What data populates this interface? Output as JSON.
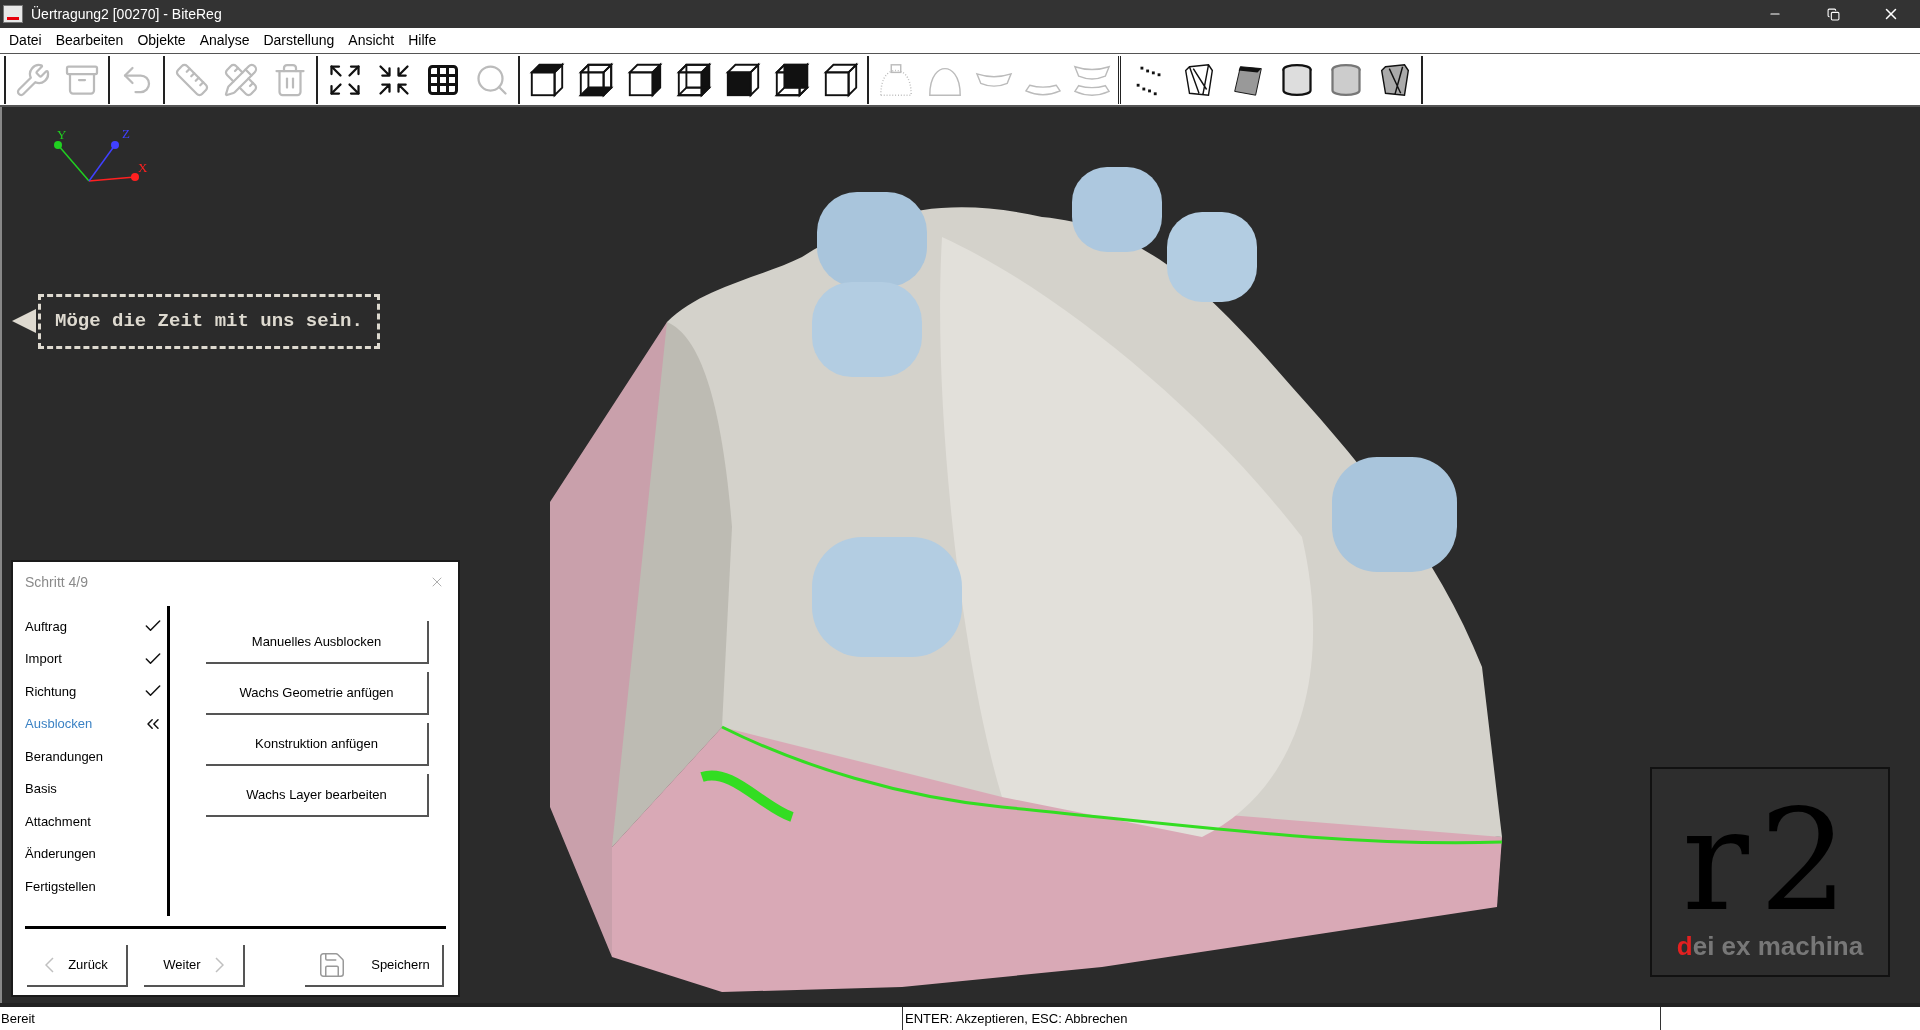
{
  "window": {
    "title": "Üertragung2 [00270] - BiteReg"
  },
  "menu": [
    "Datei",
    "Bearbeiten",
    "Objekte",
    "Analyse",
    "Darstellung",
    "Ansicht",
    "Hilfe"
  ],
  "toolbar": {
    "groups": [
      [
        {
          "kind": "wrench",
          "disabled": true
        },
        {
          "kind": "archive",
          "disabled": true
        }
      ],
      [
        {
          "kind": "undo",
          "disabled": true
        }
      ],
      [
        {
          "kind": "ruler",
          "disabled": true
        },
        {
          "kind": "edit-tools",
          "disabled": true
        },
        {
          "kind": "trash",
          "disabled": true
        }
      ],
      [
        {
          "kind": "zoom-fit",
          "disabled": false
        },
        {
          "kind": "zoom-center",
          "disabled": false
        },
        {
          "kind": "grid",
          "disabled": false
        },
        {
          "kind": "magnifier",
          "disabled": true
        }
      ],
      [
        {
          "kind": "cube-top",
          "disabled": false
        },
        {
          "kind": "wire-cube-bottom",
          "disabled": false
        },
        {
          "kind": "cube-right",
          "disabled": false
        },
        {
          "kind": "wire-cube-right",
          "disabled": false
        },
        {
          "kind": "cube-front",
          "disabled": false
        },
        {
          "kind": "wire-cube-back",
          "disabled": false
        },
        {
          "kind": "cube-plain",
          "disabled": false
        }
      ],
      [
        {
          "kind": "jaw-base",
          "disabled": true
        },
        {
          "kind": "arch",
          "disabled": true
        },
        {
          "kind": "upper-teeth",
          "disabled": true
        },
        {
          "kind": "lower-teeth",
          "disabled": true
        },
        {
          "kind": "both-teeth",
          "disabled": true
        }
      ],
      [
        {
          "kind": "points",
          "disabled": false
        },
        {
          "kind": "mesh",
          "disabled": false
        },
        {
          "kind": "prism",
          "disabled": false
        },
        {
          "kind": "cylinder",
          "disabled": false
        },
        {
          "kind": "smooth-cylinder",
          "disabled": false
        },
        {
          "kind": "wire-cylinder",
          "disabled": false
        }
      ]
    ]
  },
  "viewport": {
    "axes": [
      {
        "label": "X",
        "color": "#ff2020"
      },
      {
        "label": "Y",
        "color": "#20d020"
      },
      {
        "label": "Z",
        "color": "#4040ff"
      }
    ],
    "hint": "Möge die Zeit mit uns sein.",
    "logo": {
      "mark": "r2",
      "tagline": "dei ex machina"
    }
  },
  "wizard": {
    "title": "Schritt 4/9",
    "steps": [
      {
        "label": "Auftrag",
        "checked": true,
        "selected": false
      },
      {
        "label": "Import",
        "checked": true,
        "selected": false
      },
      {
        "label": "Richtung",
        "checked": true,
        "selected": false
      },
      {
        "label": "Ausblocken",
        "checked": false,
        "selected": true
      },
      {
        "label": "Berandungen",
        "checked": false,
        "selected": false
      },
      {
        "label": "Basis",
        "checked": false,
        "selected": false
      },
      {
        "label": "Attachment",
        "checked": false,
        "selected": false
      },
      {
        "label": "Änderungen",
        "checked": false,
        "selected": false
      },
      {
        "label": "Fertigstellen",
        "checked": false,
        "selected": false
      }
    ],
    "actions": [
      "Manuelles Ausblocken",
      "Wachs Geometrie anfügen",
      "Konstruktion anfügen",
      "Wachs Layer bearbeiten"
    ],
    "back": "Zurück",
    "next": "Weiter",
    "save": "Speichern"
  },
  "status_bar": [
    "Bereit",
    "ENTER: Akzeptieren, ESC: Abbrechen"
  ]
}
